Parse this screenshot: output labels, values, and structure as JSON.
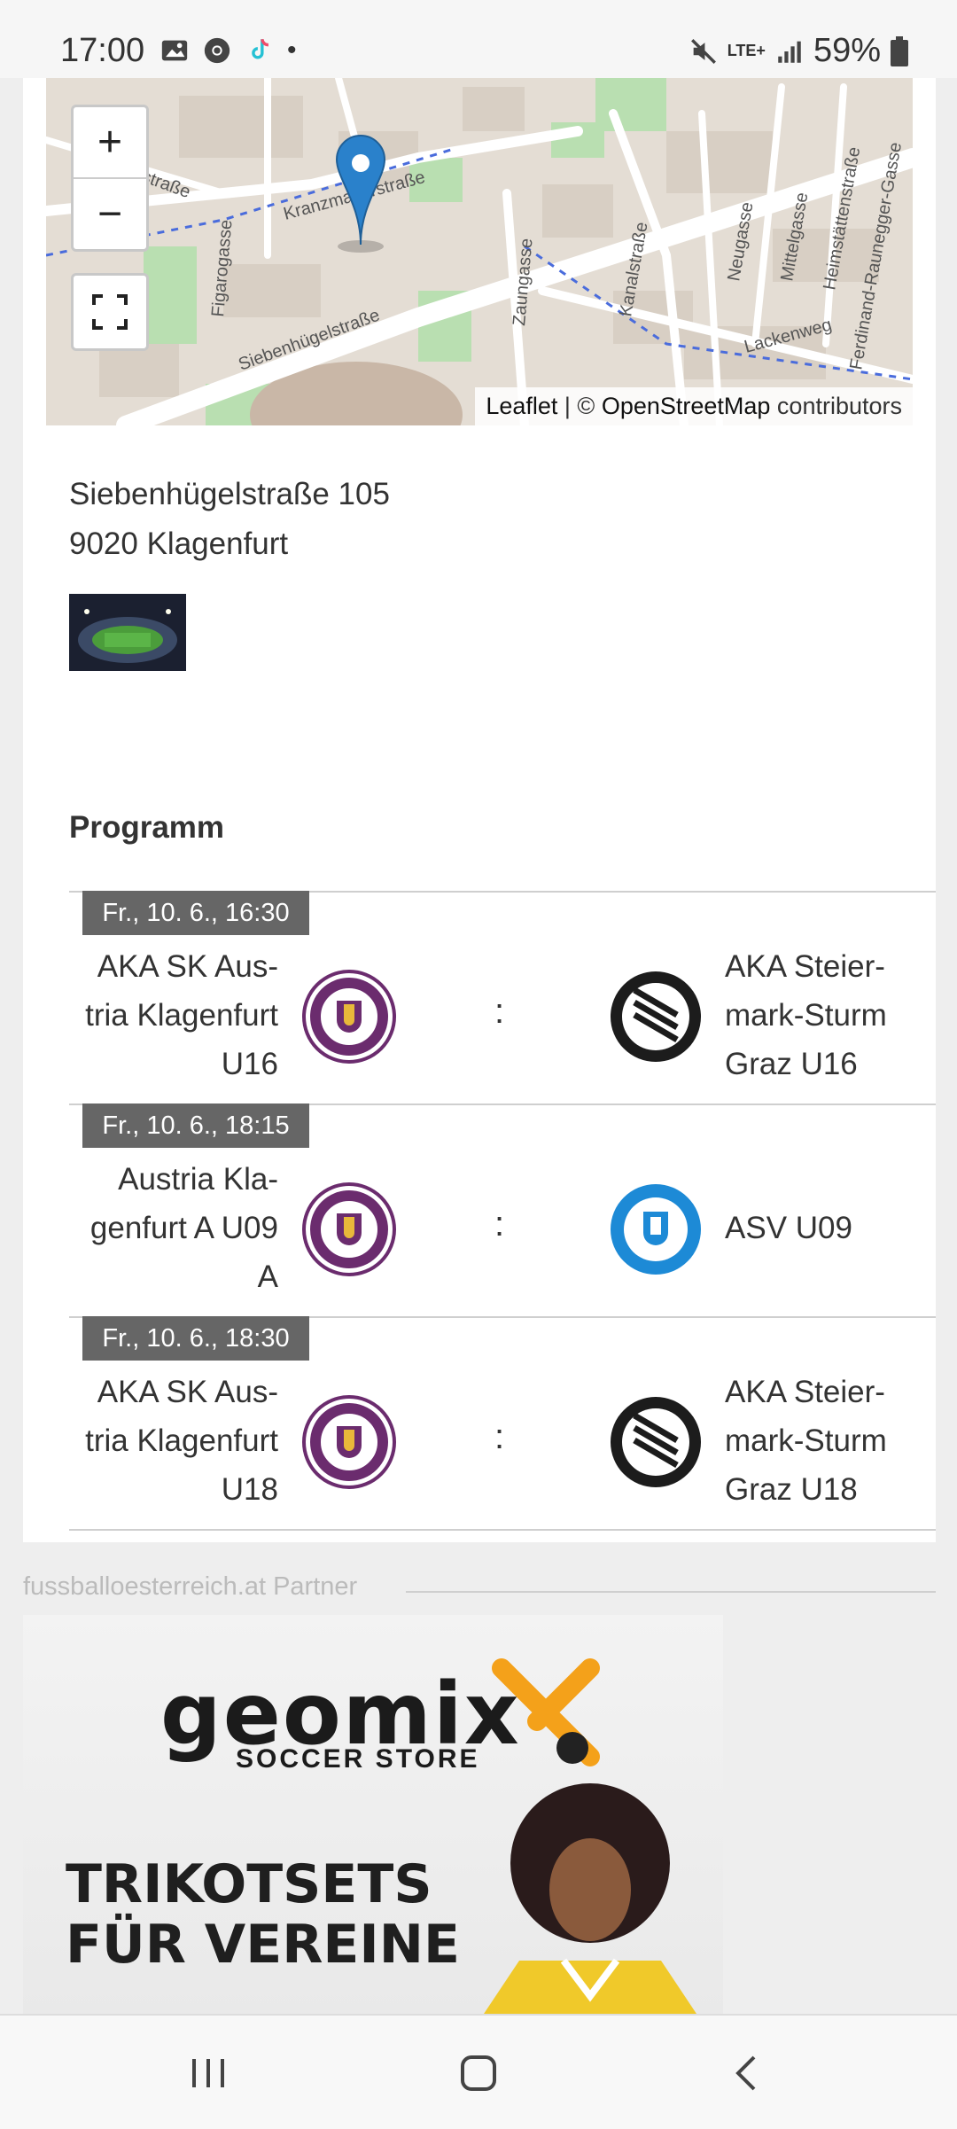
{
  "status_bar": {
    "time": "17:00",
    "network": "LTE+",
    "battery": "59%"
  },
  "map": {
    "zoom_in": "+",
    "zoom_out": "−",
    "attribution_link": "Leaflet",
    "attribution_sep": " | © ",
    "attribution_osm": "OpenStreetMap",
    "attribution_tail": " contributors",
    "street_labels": [
      "Kranzmayerstraße",
      "Siebenhügelstraße",
      "Zaungasse",
      "Kanalstraße",
      "Neugasse",
      "Mittelgasse",
      "Heimstättenstraße",
      "Lackenweg",
      "Ferdinand-Raunegger-Gasse",
      "Figarogasse",
      "erstraße"
    ]
  },
  "address": {
    "line1": "Siebenhügelstraße 105",
    "line2": "9020 Klagenfurt"
  },
  "program": {
    "title": "Programm",
    "matches": [
      {
        "date": "Fr., 10. 6., 16:30",
        "home": "AKA SK Aus-\ntria Klagenfurt\nU16",
        "away": "AKA Steier-\nmark-Sturm\nGraz U16",
        "separator": ":",
        "home_logo": "austria-klagenfurt-logo",
        "away_logo": "sturm-graz-logo"
      },
      {
        "date": "Fr., 10. 6., 18:15",
        "home": "Austria Kla-\ngenfurt A U09\nA",
        "away": "ASV U09",
        "separator": ":",
        "home_logo": "austria-klagenfurt-logo",
        "away_logo": "annabichler-sv-logo"
      },
      {
        "date": "Fr., 10. 6., 18:30",
        "home": "AKA SK Aus-\ntria Klagenfurt\nU18",
        "away": "AKA Steier-\nmark-Sturm\nGraz U18",
        "separator": ":",
        "home_logo": "austria-klagenfurt-logo",
        "away_logo": "sturm-graz-logo"
      }
    ]
  },
  "partner": {
    "label": "fussballoesterreich.at Partner",
    "ad_brand": "geomix",
    "ad_sub": "SOCCER STORE",
    "ad_headline_1": "TRIKOTSETS",
    "ad_headline_2": "FÜR VEREINE"
  },
  "colors": {
    "austria_purple": "#6b2c6e",
    "badge_grey": "#666666",
    "marker_blue": "#2a81cb",
    "asv_blue": "#1d8ad6"
  }
}
